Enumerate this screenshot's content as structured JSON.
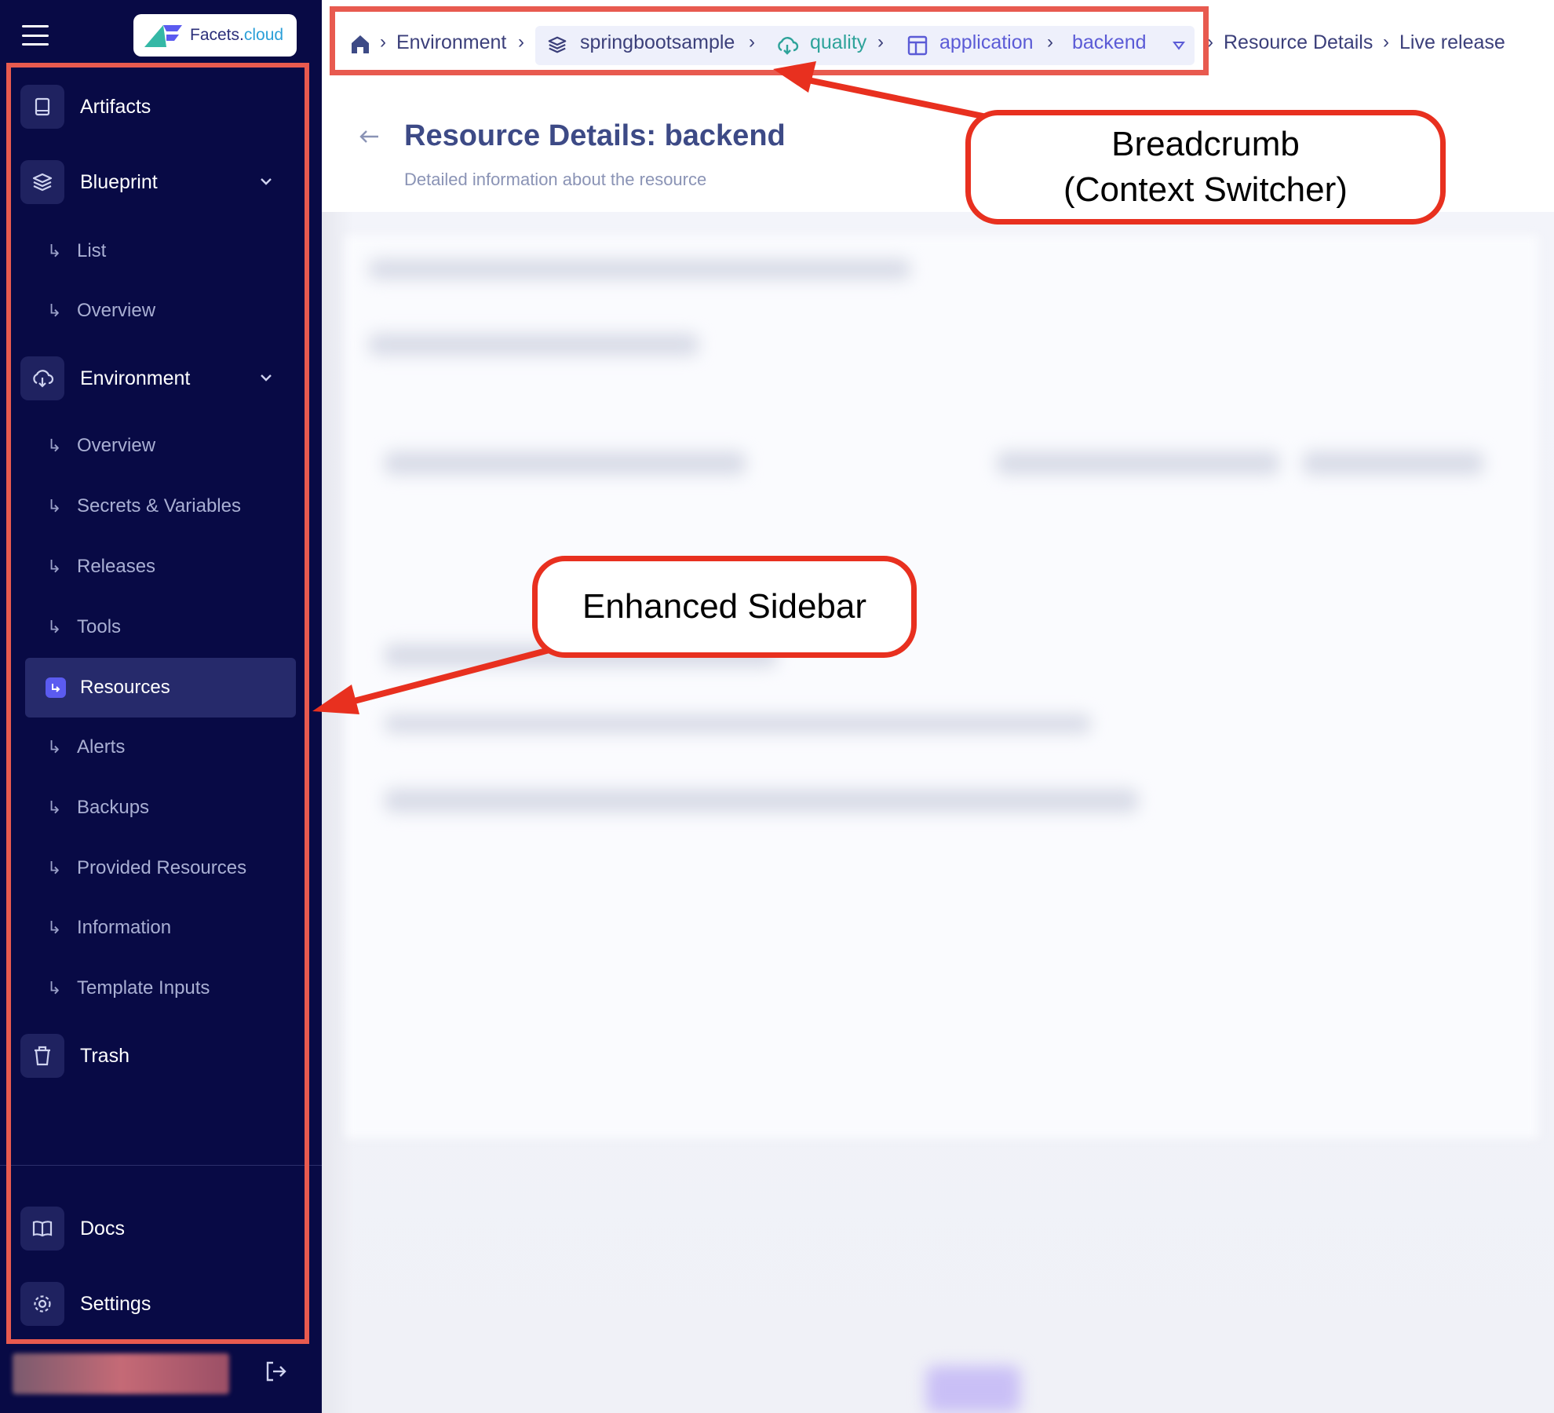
{
  "app": {
    "logo_text": "Facets.",
    "logo_accent": "cloud"
  },
  "sidebar": {
    "items": [
      {
        "label": "Artifacts",
        "icon": "book-icon"
      },
      {
        "label": "Blueprint",
        "icon": "layers-icon"
      },
      {
        "label": "List"
      },
      {
        "label": "Overview"
      },
      {
        "label": "Environment",
        "icon": "cloud-download-icon"
      },
      {
        "label": "Overview"
      },
      {
        "label": "Secrets & Variables"
      },
      {
        "label": "Releases"
      },
      {
        "label": "Tools"
      },
      {
        "label": "Resources",
        "active": true
      },
      {
        "label": "Alerts"
      },
      {
        "label": "Backups"
      },
      {
        "label": "Provided Resources"
      },
      {
        "label": "Information"
      },
      {
        "label": "Template Inputs"
      },
      {
        "label": "Trash",
        "icon": "trash-icon"
      }
    ],
    "footer": [
      {
        "label": "Docs",
        "icon": "open-book-icon"
      },
      {
        "label": "Settings",
        "icon": "gear-icon"
      }
    ]
  },
  "breadcrumb": {
    "environment": "Environment",
    "project": "springbootsample",
    "env": "quality",
    "resource_type": "application",
    "resource": "backend",
    "page": "Resource Details",
    "current": "Live release"
  },
  "page": {
    "title": "Resource Details: backend",
    "subtitle": "Detailed information about the resource"
  },
  "annotations": {
    "breadcrumb_line1": "Breadcrumb",
    "breadcrumb_line2": "(Context Switcher)",
    "sidebar": "Enhanced Sidebar"
  },
  "colors": {
    "sidebar_bg": "#080a45",
    "annotation_red": "#e8301f",
    "title_blue": "#3d4a86",
    "accent_purple": "#5b5bf0"
  }
}
